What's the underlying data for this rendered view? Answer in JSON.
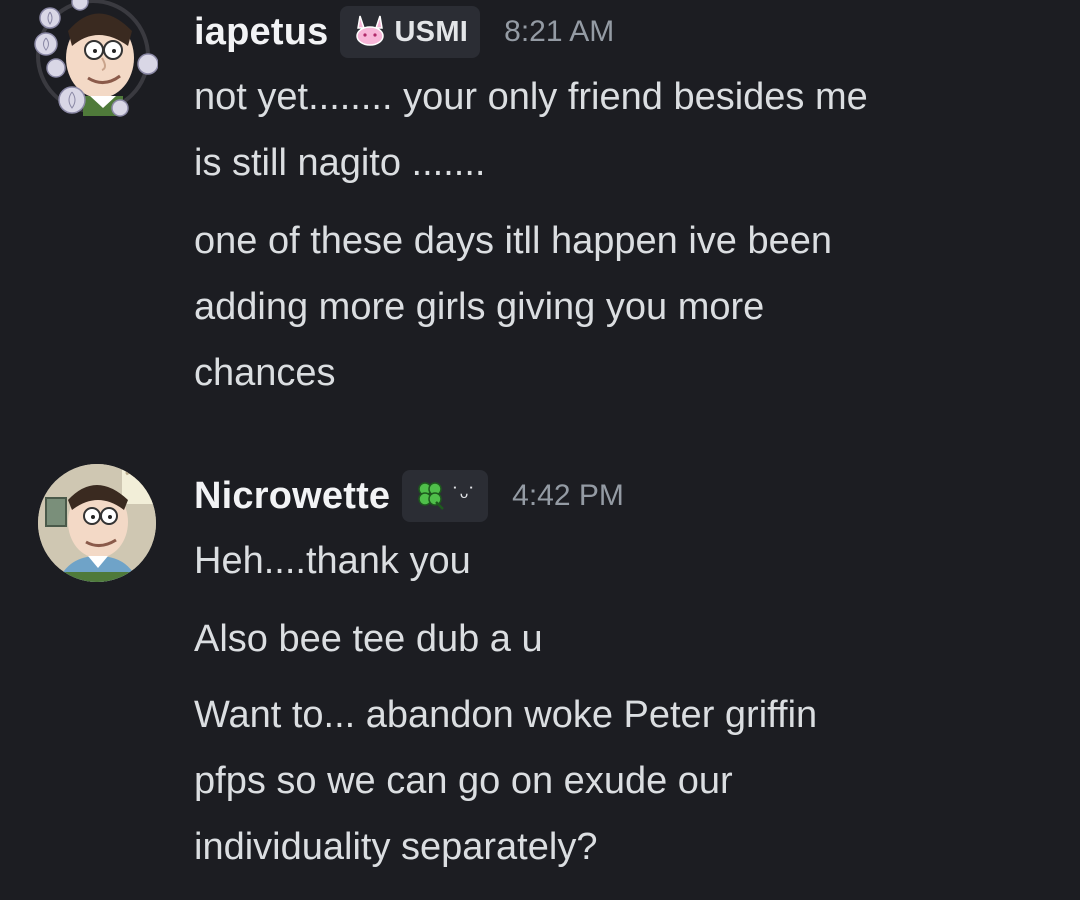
{
  "messages": [
    {
      "username": "iapetus",
      "tag": {
        "icon": "bunny-icon",
        "text": "USMI"
      },
      "time": "8:21 AM",
      "lines": [
        "not yet........ your only friend besides me",
        "is still nagito .......",
        "one of these days itll happen ive been",
        "adding more girls giving you more",
        "chances"
      ]
    },
    {
      "username": "Nicrowette",
      "tag": {
        "icon": "clover-icon",
        "text": "˙ᵕ˙"
      },
      "time": "4:42 PM",
      "lines": [
        "Heh....thank you",
        "Also bee tee dub a u",
        "Want to... abandon woke Peter griffin",
        "pfps so we can go on exude our",
        "individuality separately?"
      ]
    }
  ],
  "colors": {
    "background": "#1c1d22",
    "username": "#f2f3f5",
    "message_text": "#dbdee1",
    "timestamp": "#949ba4",
    "tag_background": "#2b2d34"
  }
}
